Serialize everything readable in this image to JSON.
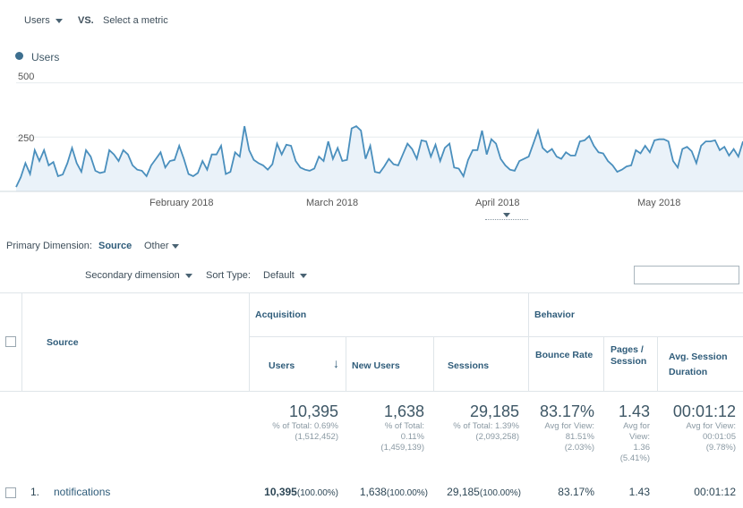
{
  "metric_bar": {
    "metric": "Users",
    "vs": "VS.",
    "select_metric": "Select a metric"
  },
  "legend": {
    "label": "Users",
    "color": "#58a3c9"
  },
  "chart_data": {
    "type": "line",
    "title": "",
    "series": [
      {
        "name": "Users",
        "values": [
          20,
          65,
          130,
          80,
          190,
          140,
          190,
          120,
          135,
          70,
          78,
          130,
          200,
          130,
          90,
          190,
          160,
          95,
          85,
          90,
          190,
          170,
          140,
          190,
          170,
          120,
          100,
          95,
          70,
          120,
          150,
          180,
          110,
          140,
          145,
          210,
          150,
          80,
          70,
          85,
          140,
          100,
          170,
          170,
          210,
          80,
          90,
          180,
          160,
          300,
          190,
          145,
          130,
          120,
          100,
          125,
          220,
          170,
          215,
          210,
          140,
          110,
          100,
          95,
          105,
          160,
          140,
          230,
          150,
          200,
          140,
          145,
          290,
          300,
          280,
          150,
          210,
          90,
          85,
          115,
          150,
          125,
          120,
          170,
          220,
          195,
          150,
          235,
          230,
          160,
          215,
          140,
          200,
          220,
          110,
          105,
          70,
          145,
          190,
          190,
          280,
          170,
          240,
          220,
          150,
          120,
          100,
          95,
          140,
          150,
          160,
          220,
          280,
          200,
          180,
          195,
          160,
          150,
          180,
          165,
          165,
          230,
          235,
          255,
          210,
          180,
          175,
          140,
          120,
          90,
          100,
          115,
          120,
          190,
          175,
          210,
          180,
          235,
          240,
          240,
          230,
          140,
          110,
          195,
          205,
          185,
          130,
          210,
          230,
          230,
          235,
          190,
          205,
          165,
          195,
          160,
          230
        ]
      }
    ],
    "x_tick_labels": [
      "February 2018",
      "March 2018",
      "April 2018",
      "May 2018"
    ],
    "y_tick_labels": [
      "500",
      "250"
    ],
    "ylim": [
      0,
      560
    ],
    "line_color": "#4a8fbd",
    "fill_color": "#dceaf5"
  },
  "primary_dimension": {
    "label": "Primary Dimension:",
    "value": "Source",
    "other": "Other"
  },
  "toolbar": {
    "secondary_dimension": "Secondary dimension",
    "sort_type_label": "Sort Type:",
    "sort_type_value": "Default",
    "search_placeholder": ""
  },
  "table": {
    "source_header": "Source",
    "acquisition_header": "Acquisition",
    "behavior_header": "Behavior",
    "columns": [
      "Users",
      "New Users",
      "Sessions",
      "Bounce Rate",
      "Pages / Session",
      "Avg. Session Duration"
    ],
    "totals": [
      {
        "value": "10,395",
        "l1": "% of Total: 0.69%",
        "l2": "(1,512,452)"
      },
      {
        "value": "1,638",
        "l1": "% of Total:",
        "l2": "0.11%",
        "l3": "(1,459,139)"
      },
      {
        "value": "29,185",
        "l1": "% of Total: 1.39%",
        "l2": "(2,093,258)"
      },
      {
        "value": "83.17%",
        "l1": "Avg for View:",
        "l2": "81.51%",
        "l3": "(2.03%)"
      },
      {
        "value": "1.43",
        "l1": "Avg for",
        "l2": "View:",
        "l3": "1.36",
        "l4": "(5.41%)"
      },
      {
        "value": "00:01:12",
        "l1": "Avg for View:",
        "l2": "00:01:05",
        "l3": "(9.78%)"
      }
    ],
    "rows": [
      {
        "index": "1.",
        "source": "notifications",
        "users": "10,395",
        "users_pct": "(100.00%)",
        "new_users": "1,638",
        "new_users_pct": "(100.00%)",
        "sessions": "29,185",
        "sessions_pct": "(100.00%)",
        "bounce_rate": "83.17%",
        "pages_session": "1.43",
        "avg_duration": "00:01:12"
      }
    ]
  }
}
